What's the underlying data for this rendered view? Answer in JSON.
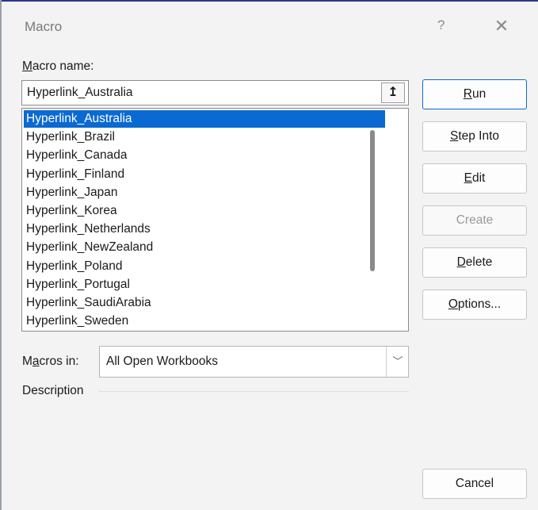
{
  "window": {
    "title": "Macro",
    "help": "?",
    "close": "✕"
  },
  "macro_name": {
    "label_accel": "M",
    "label_rest": "acro name:",
    "value": "Hyperlink_Australia",
    "upload_icon": "↥"
  },
  "list": {
    "items": [
      "Hyperlink_Australia",
      "Hyperlink_Brazil",
      "Hyperlink_Canada",
      "Hyperlink_Finland",
      "Hyperlink_Japan",
      "Hyperlink_Korea",
      "Hyperlink_Netherlands",
      "Hyperlink_NewZealand",
      "Hyperlink_Poland",
      "Hyperlink_Portugal",
      "Hyperlink_SaudiArabia",
      "Hyperlink_Sweden"
    ],
    "selected_index": 0
  },
  "buttons": {
    "run": {
      "accel": "R",
      "rest": "un"
    },
    "step_into": {
      "accel": "S",
      "rest": "tep Into"
    },
    "edit": {
      "accel": "E",
      "rest": "dit"
    },
    "create": {
      "label": "Create"
    },
    "delete": {
      "accel": "D",
      "rest": "elete"
    },
    "options": {
      "accel": "O",
      "rest": "ptions..."
    },
    "cancel": {
      "label": "Cancel"
    }
  },
  "macros_in": {
    "label_pre": "M",
    "label_accel": "a",
    "label_rest": "cros in:",
    "value": "All Open Workbooks",
    "chevron": "﹀"
  },
  "description": {
    "label": "Description"
  },
  "colors": {
    "accent": "#0a6ad2",
    "title_border": "#2b3a8f"
  }
}
